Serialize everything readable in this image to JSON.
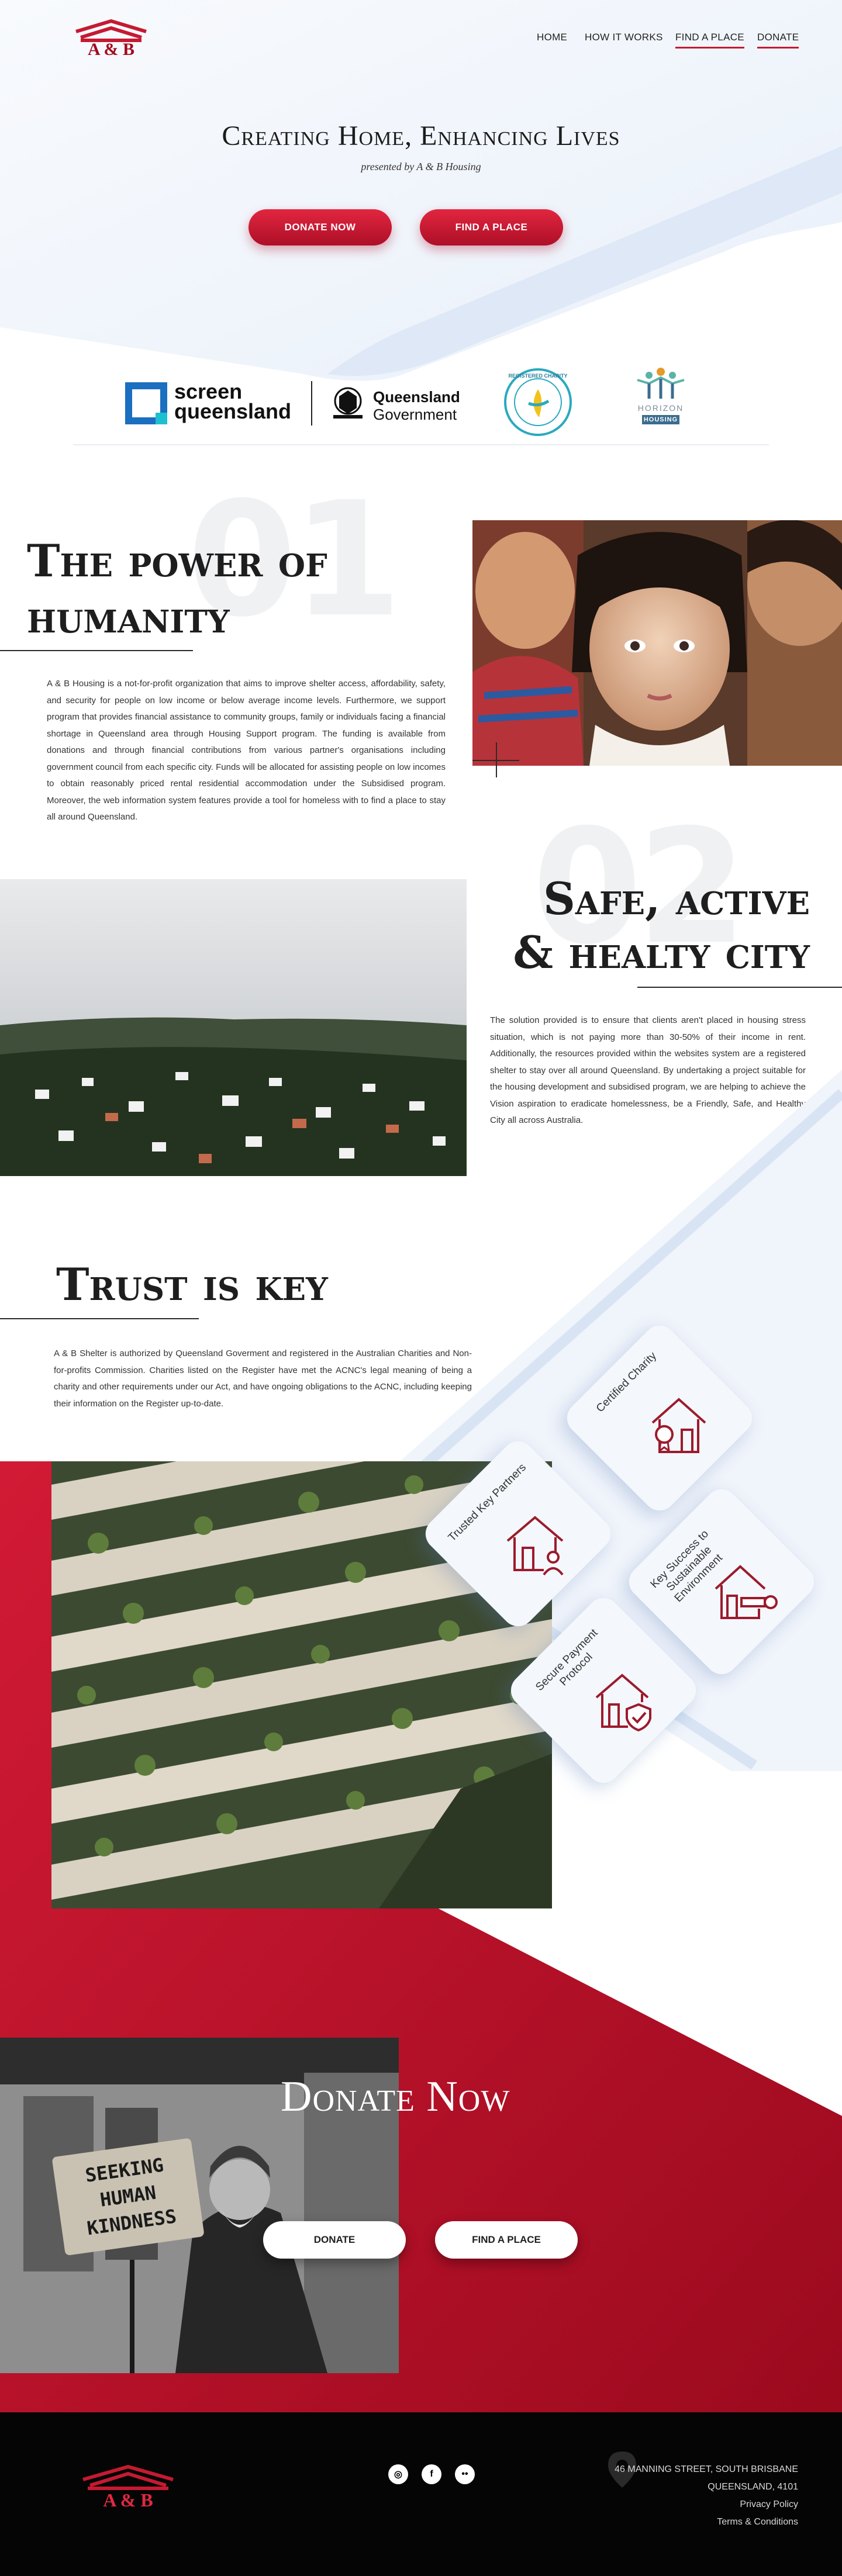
{
  "brand": {
    "logo_text": "A & B"
  },
  "nav": {
    "items": [
      "HOME",
      "HOW IT WORKS",
      "FIND A PLACE",
      "DONATE"
    ]
  },
  "hero": {
    "title": "Creating Home, Enhancing Lives",
    "subtitle": "presented by A & B Housing",
    "primary_button": "DONATE NOW",
    "secondary_button": "FIND A PLACE"
  },
  "partners": {
    "screen_line1": "screen",
    "screen_line2": "queensland",
    "qld_line1": "Queensland",
    "qld_line2": "Government",
    "charity_text": "REGISTERED CHARITY",
    "horizon_line1": "HORIZON",
    "horizon_line2": "HOUSING"
  },
  "section1": {
    "number": "01",
    "title_line1": "The power of",
    "title_line2": "humanity",
    "body": "A & B Housing is a not-for-profit organization that aims to improve shelter access, affordability, safety, and security for people on low income or below average income levels. Furthermore, we support program that provides financial assistance to community groups, family or individuals facing a financial shortage in Queensland area through Housing Support program. The funding is available from donations and through financial contributions from various partner's organisations including government council from each specific city. Funds will be allocated for assisting people on low incomes to obtain reasonably priced rental residential accommodation under the Subsidised program. Moreover, the web information system features provide a tool for homeless with to find a place to stay all around Queensland."
  },
  "section2": {
    "number": "02",
    "title_line1": "Safe, active",
    "title_line2": "& healty city",
    "body": "The solution provided is to ensure that clients aren't placed in housing stress situation, which is not paying more than 30-50% of their income in rent. Additionally, the resources provided within the websites system are a registered shelter to stay over all around Queensland. By undertaking a project suitable for the housing development and subsidised program, we are helping to achieve the Vision aspiration to eradicate homelessness, be a Friendly, Safe, and Healthy City all across Australia."
  },
  "section3": {
    "title": "Trust is key",
    "body": "A & B Shelter is authorized by Queensland Goverment and registered in the Australian Charities and Non-for-profits Commission. Charities listed on the Register have met the ACNC's legal meaning of being a charity and other requirements under our Act, and have ongoing obligations to the ACNC, including keeping their information on the Register up-to-date.",
    "cards": [
      {
        "label": "Certified Charity",
        "icon": "house-badge-icon"
      },
      {
        "label": "Trusted Key Partners",
        "icon": "house-person-icon"
      },
      {
        "label": "Key Success to Sustainable Environment",
        "icon": "house-key-icon"
      },
      {
        "label": "Secure Payment Protocol",
        "icon": "house-shield-icon"
      }
    ]
  },
  "donate": {
    "title": "Donate Now",
    "donate_button": "DONATE",
    "find_button": "FIND A PLACE",
    "sign_text": "SEEKING HUMAN KINDNESS"
  },
  "footer": {
    "address_line1": "46 MANNING STREET, SOUTH BRISBANE",
    "address_line2": "QUEENSLAND, 4101",
    "privacy": "Privacy Policy",
    "terms": "Terms & Conditions",
    "social": [
      "instagram-icon",
      "facebook-icon",
      "flickr-icon"
    ]
  },
  "colors": {
    "accent": "#c51a31",
    "dark_red": "#a30a1f",
    "light_blue": "#eef3fb"
  }
}
